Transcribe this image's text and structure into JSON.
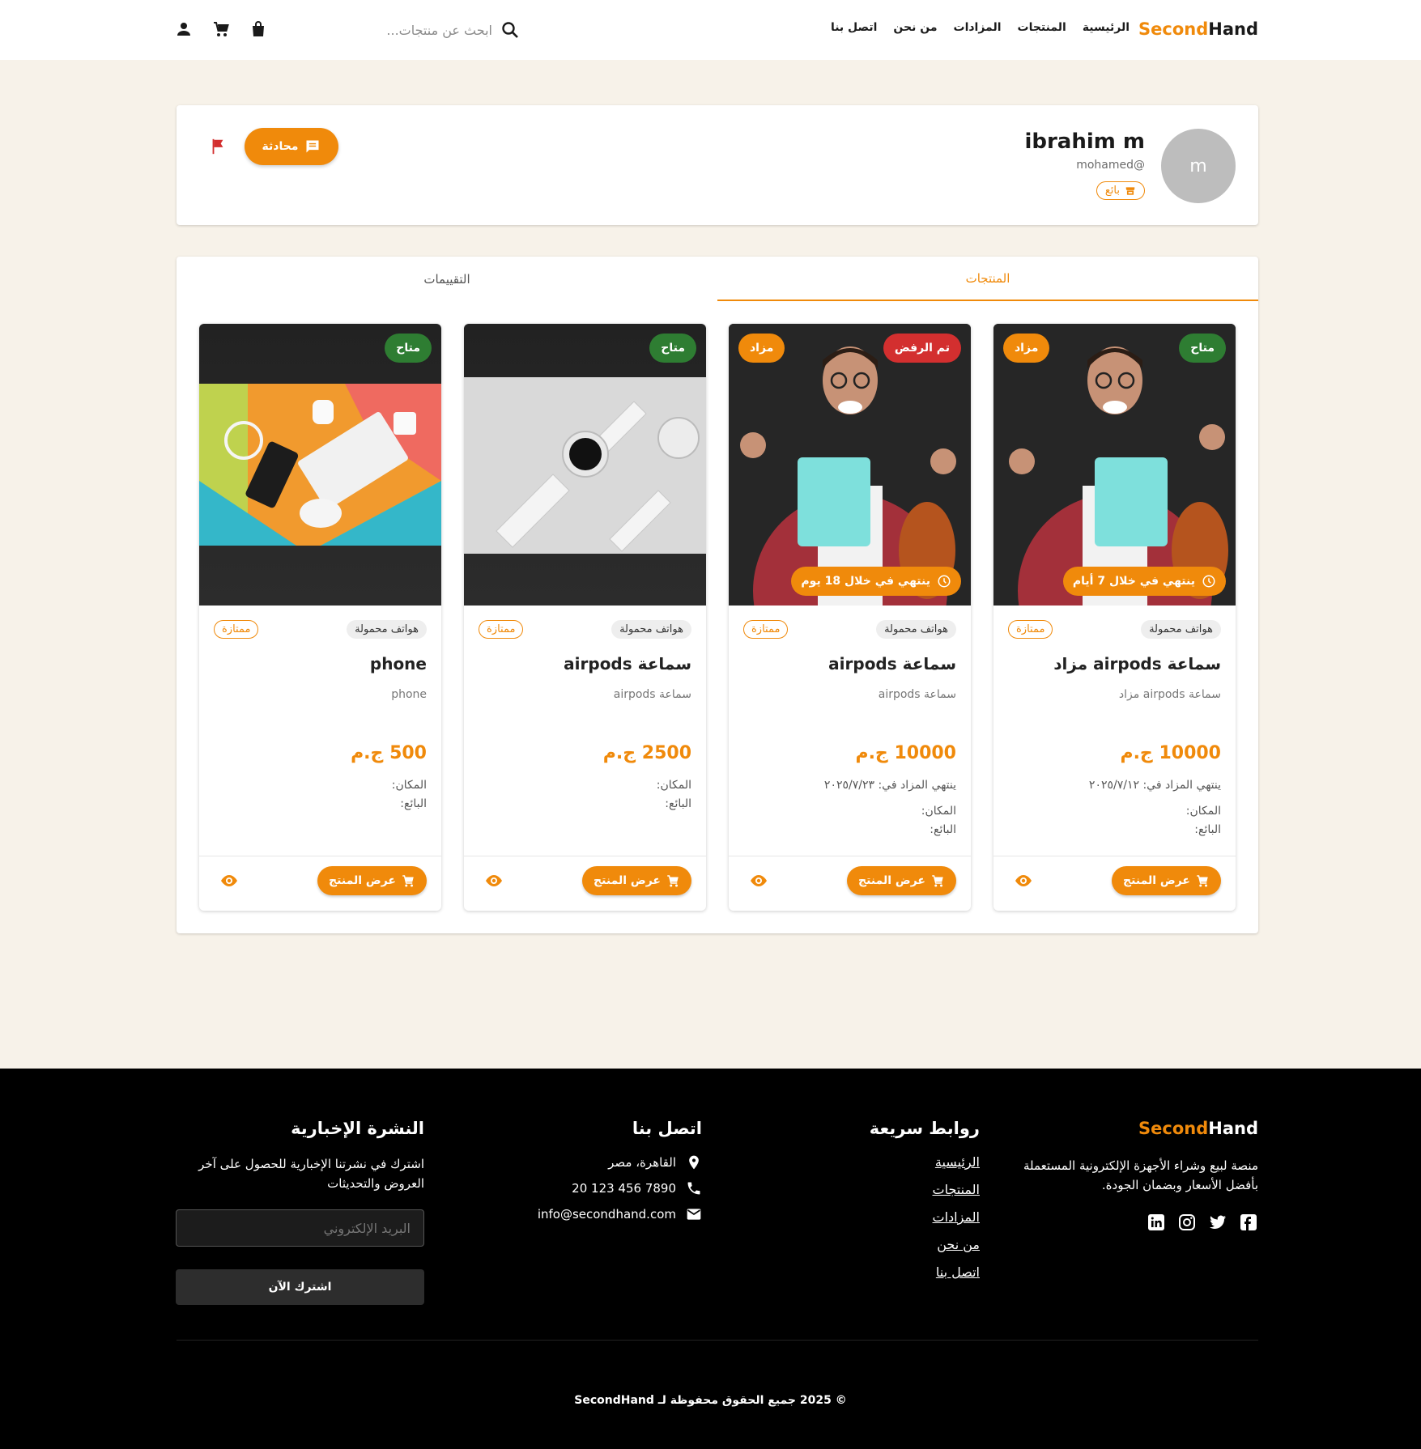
{
  "nav": {
    "logo_part1": "Second",
    "logo_part2": "Hand",
    "links": [
      "الرئيسية",
      "المنتجات",
      "المزادات",
      "من نحن",
      "اتصل بنا"
    ],
    "search_placeholder": "ابحث عن منتجات...",
    "icons": [
      "search-icon",
      "bag-icon",
      "cart-icon",
      "person-icon"
    ]
  },
  "profile": {
    "avatar_letter": "m",
    "name": "ibrahim m",
    "username": "mohamed@",
    "role_badge": "بائع",
    "chat_button": "محادثة"
  },
  "tabs": {
    "products": "المنتجات",
    "reviews": "التقييمات"
  },
  "products": [
    {
      "status": "متاح",
      "status_color": "#2e7d32",
      "auction_badge": "مزاد",
      "timer": "ينتهي في خلال 7 أيام",
      "category": "هواتف محمولة",
      "condition": "ممتازة",
      "title": "سماعة airpods مزاد",
      "desc": "سماعة airpods مزاد",
      "price": "10000 ج.م",
      "auction_end": "ينتهي المزاد في: ٢٠٢٥/٧/١٢",
      "location_label": "المكان:",
      "seller_label": "البائع:",
      "view_label": "عرض المنتج"
    },
    {
      "status": "تم الرفض",
      "status_color": "#d32f2f",
      "auction_badge": "مزاد",
      "timer": "ينتهي في خلال 18 يوم",
      "category": "هواتف محمولة",
      "condition": "ممتازة",
      "title": "سماعة airpods",
      "desc": "سماعة airpods",
      "price": "10000 ج.م",
      "auction_end": "ينتهي المزاد في: ٢٠٢٥/٧/٢٣",
      "location_label": "المكان:",
      "seller_label": "البائع:",
      "view_label": "عرض المنتج"
    },
    {
      "status": "متاح",
      "status_color": "#2e7d32",
      "category": "هواتف محمولة",
      "condition": "ممتازة",
      "title": "سماعة airpods",
      "desc": "سماعة airpods",
      "price": "2500 ج.م",
      "location_label": "المكان:",
      "seller_label": "البائع:",
      "view_label": "عرض المنتج"
    },
    {
      "status": "متاح",
      "status_color": "#2e7d32",
      "category": "هواتف محمولة",
      "condition": "ممتازة",
      "title": "phone",
      "desc": "phone",
      "price": "500 ج.م",
      "location_label": "المكان:",
      "seller_label": "البائع:",
      "view_label": "عرض المنتج"
    }
  ],
  "footer": {
    "logo_part1": "Second",
    "logo_part2": "Hand",
    "about": "منصة لبيع وشراء الأجهزة الإلكترونية المستعملة بأفضل الأسعار وبضمان الجودة.",
    "quick_links_title": "روابط سريعة",
    "quick_links": [
      "الرئيسية",
      "المنتجات",
      "المزادات",
      "من نحن",
      "اتصل بنا"
    ],
    "contact_title": "اتصل بنا",
    "address": "القاهرة، مصر",
    "phone": "20 123 456 7890",
    "email": "info@secondhand.com",
    "newsletter_title": "النشرة الإخبارية",
    "newsletter_text": "اشترك في نشرتنا الإخبارية للحصول على آخر العروض والتحديثات",
    "email_placeholder": "البريد الإلكتروني",
    "subscribe_label": "اشترك الآن",
    "copyright": "© 2025 جميع الحقوق محفوظة لـ SecondHand"
  },
  "colors": {
    "accent": "#f08a0b",
    "page_bg": "#f7f2e9",
    "footer_bg": "#000000"
  }
}
